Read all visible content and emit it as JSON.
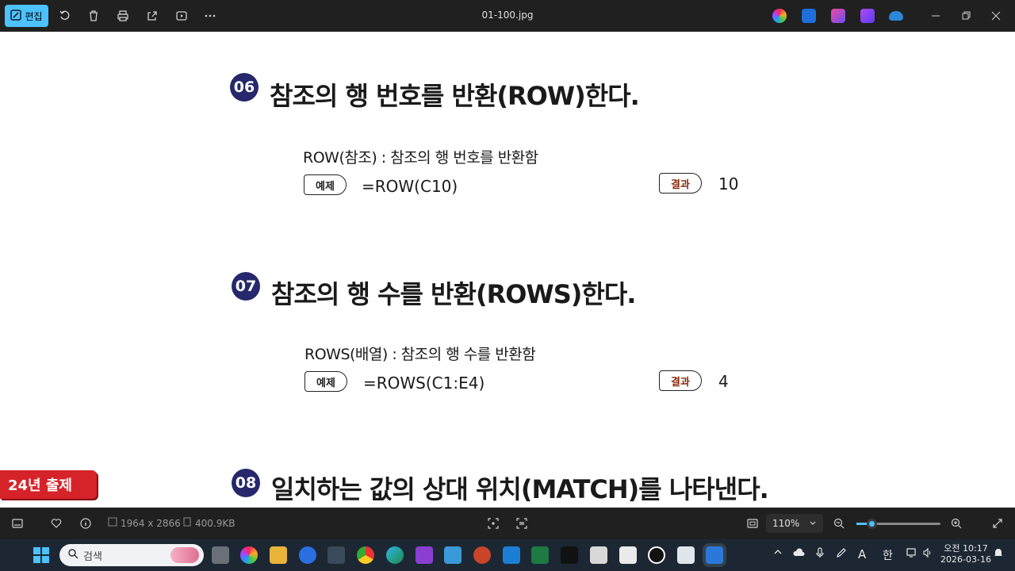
{
  "toolbar": {
    "edit_label": "편집",
    "title": "01-100.jpg",
    "icons": [
      "rotate-icon",
      "delete-icon",
      "print-icon",
      "share-icon",
      "slideshow-icon",
      "more-icon"
    ]
  },
  "document": {
    "sections": [
      {
        "number": "06",
        "heading": "참조의 행 번호를 반환(ROW)한다.",
        "description": "ROW(참조) : 참조의 행 번호를 반환함",
        "example_tag": "예제",
        "formula": "=ROW(C10)",
        "result_tag": "결과",
        "result": "10"
      },
      {
        "number": "07",
        "heading": "참조의 행 수를 반환(ROWS)한다.",
        "description": "ROWS(배열) : 참조의 행 수를 반환함",
        "example_tag": "예제",
        "formula": "=ROWS(C1:E4)",
        "result_tag": "결과",
        "result": "4"
      },
      {
        "number": "08",
        "heading": "일치하는 값의 상대 위치(MATCH)를 나타낸다."
      }
    ],
    "exam_badge": "24년 출제"
  },
  "statusbar": {
    "dimensions": "1964 x 2866",
    "filesize": "400.9KB",
    "zoom": "110%",
    "zoom_fraction": 0.18
  },
  "taskbar": {
    "search_placeholder": "검색",
    "ime": "한",
    "clock_time": "오전 10:17",
    "clock_date": "2026-03-16"
  },
  "colors": {
    "accent": "#4cc2ff",
    "badge_navy": "#26286b",
    "exam_red": "#d6232a"
  }
}
